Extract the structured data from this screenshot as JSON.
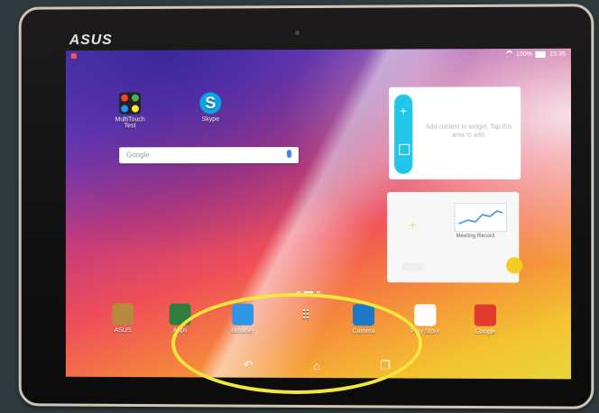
{
  "device": {
    "brand": "ASUS"
  },
  "status_bar": {
    "battery": "100%",
    "time": "15:35",
    "icons": [
      "wifi-icon",
      "battery-icon"
    ]
  },
  "home_screen": {
    "apps_top": [
      {
        "label": "MultiTouch Test",
        "icon": "multitouch-icon"
      },
      {
        "label": "Skype",
        "icon": "skype-icon"
      }
    ],
    "search": {
      "label": "Google"
    },
    "widgets": [
      {
        "name": "quick-memo",
        "text": "Add content to widget.\nTap this area to add."
      },
      {
        "name": "meeting-record",
        "label": "Meeting Record"
      }
    ],
    "dock": [
      {
        "label": "ASUS",
        "icon": "folder-icon"
      },
      {
        "label": "Apps",
        "icon": "folder-icon"
      },
      {
        "label": "Browser",
        "icon": "browser-icon"
      },
      {
        "label": "",
        "icon": "app-drawer-icon"
      },
      {
        "label": "Camera",
        "icon": "camera-icon"
      },
      {
        "label": "Play Store",
        "icon": "play-store-icon"
      },
      {
        "label": "Google",
        "icon": "google-folder-icon"
      }
    ],
    "nav": [
      "back-icon",
      "home-icon",
      "recents-icon"
    ]
  },
  "annotation": {
    "shape": "ellipse",
    "color": "#f3e63c"
  }
}
